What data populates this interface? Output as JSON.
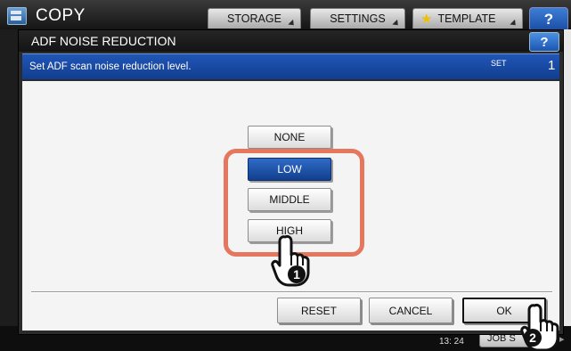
{
  "app": {
    "title": "COPY",
    "tabs": [
      {
        "label": "STORAGE"
      },
      {
        "label": "SETTINGS"
      },
      {
        "label": "TEMPLATE"
      }
    ],
    "help_label": "?",
    "clock": "13: 24",
    "job_status_label": "JOB S"
  },
  "dialog": {
    "title": "ADF NOISE REDUCTION",
    "help_label": "?",
    "instruction": "Set ADF scan noise reduction level.",
    "set_label": "SET",
    "set_count": "1",
    "options": [
      {
        "label": "NONE",
        "selected": false
      },
      {
        "label": "LOW",
        "selected": true
      },
      {
        "label": "MIDDLE",
        "selected": false
      },
      {
        "label": "HIGH",
        "selected": false
      }
    ],
    "buttons": {
      "reset": "RESET",
      "cancel": "CANCEL",
      "ok": "OK"
    }
  },
  "annotations": {
    "step_1": "1",
    "step_2": "2",
    "highlight_color": "#e4775e"
  },
  "colors": {
    "selected_option": "#1a4ea3",
    "info_bar": "#1a4ea3"
  }
}
